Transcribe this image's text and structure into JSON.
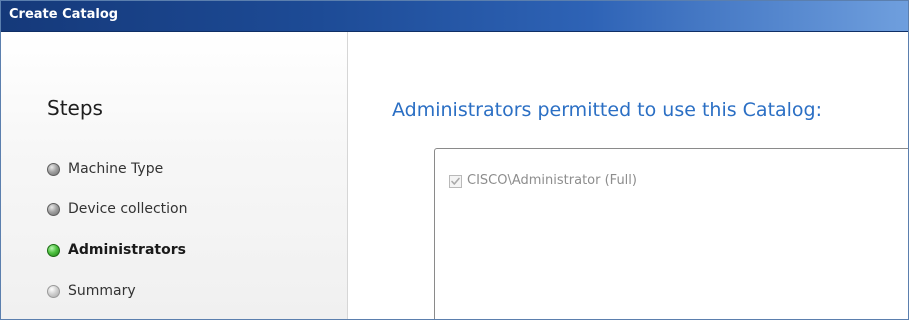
{
  "window": {
    "title": "Create Catalog"
  },
  "sidebar": {
    "heading": "Steps",
    "steps": [
      {
        "label": "Machine Type",
        "status": "completed",
        "indicator_color": "#8a8a8a"
      },
      {
        "label": "Device collection",
        "status": "completed",
        "indicator_color": "#8a8a8a"
      },
      {
        "label": "Administrators",
        "status": "current",
        "indicator_color": "#3cb332"
      },
      {
        "label": "Summary",
        "status": "pending",
        "indicator_color": "#c8c8c8"
      }
    ]
  },
  "main": {
    "heading": "Administrators permitted to use this Catalog:",
    "administrators": [
      {
        "label": "CISCO\\Administrator (Full)",
        "checked": true,
        "disabled": true
      }
    ]
  },
  "colors": {
    "titlebar": "#1d4b96",
    "heading_blue": "#2b6fc4",
    "active_step": "#3cb332"
  }
}
